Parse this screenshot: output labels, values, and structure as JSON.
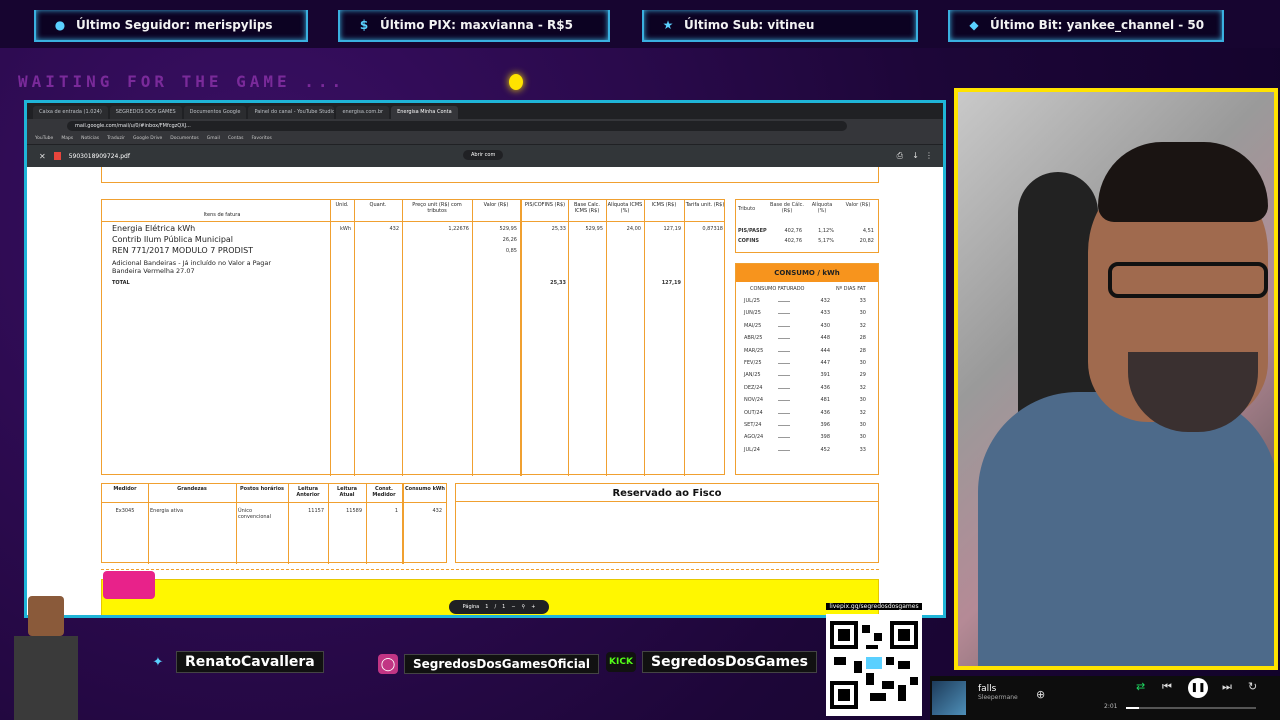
{
  "alerts": [
    {
      "icon": "user-icon",
      "label": "Último Seguidor: merispylips"
    },
    {
      "icon": "dollar-icon",
      "label": "Último PIX: maxvianna - R$5"
    },
    {
      "icon": "star-icon",
      "label": "Último Sub: vitineu"
    },
    {
      "icon": "diamond-icon",
      "label": "Último Bit: yankee_channel - 50"
    }
  ],
  "waiting_text": "WAITING FOR THE GAME ...",
  "browser": {
    "tabs": [
      "Caixa de entrada (1.024)",
      "SEGREDOS DOS GAMES",
      "Documentos Google",
      "Painel do canal - YouTube Studio",
      "energisa.com.br",
      "Energisa Minha Conta"
    ],
    "url": "mail.google.com/mail/u/0/#inbox/FMfcgzQXJ...",
    "bookmarks": [
      "YouTube",
      "Maps",
      "Notícias",
      "Traduzir",
      "Google Drive",
      "Documentos",
      "Gmail",
      "Contas",
      "Favoritos"
    ],
    "pdf_name": "5903018909724.pdf",
    "pdf_zoom": "Abrir com",
    "pager": {
      "label": "Página",
      "current": "1",
      "sep": "/",
      "total": "1"
    }
  },
  "bill": {
    "headers": [
      "Itens de fatura",
      "Unid.",
      "Quant.",
      "Preço unit (R$) com tributos",
      "Valor (R$)",
      "PIS/COFINS (R$)",
      "Base Calc. ICMS (R$)",
      "Alíquota ICMS (%)",
      "ICMS (R$)",
      "Tarifa unit. (R$)"
    ],
    "lines": [
      "Energia Elétrica kWh",
      "Contrib Ilum Pública Municipal",
      "REN 771/2017 MODULO 7 PRODIST",
      "Adicional Bandeiras - Já incluído no Valor a Pagar",
      "Bandeira Vermelha 27.07"
    ],
    "total_label": "TOTAL",
    "pis_total": "25,33",
    "icms_total": "127,19",
    "row1": {
      "unit": "kWh",
      "qty": "432",
      "price": "1,22676",
      "value": "529,95",
      "pis": "25,33",
      "base": "529,95",
      "aliq": "24,00",
      "icms": "127,19",
      "tarifa": "0,87318"
    },
    "row2_value": "26,26",
    "row3_value": "0,85"
  },
  "tributo": {
    "headers": [
      "Tributo",
      "Base de Cálc. (R$)",
      "Alíquota (%)",
      "Valor (R$)"
    ],
    "rows": [
      {
        "name": "PIS/PASEP",
        "base": "402,76",
        "aliq": "1,12%",
        "valor": "4,51"
      },
      {
        "name": "COFINS",
        "base": "402,76",
        "aliq": "5,17%",
        "valor": "20,82"
      }
    ]
  },
  "consumo": {
    "title": "CONSUMO / kWh",
    "headers": [
      "CONSUMO FATURADO",
      "Nº DIAS FAT"
    ],
    "rows": [
      {
        "m": "JUL/25",
        "v": "432",
        "d": "33"
      },
      {
        "m": "JUN/25",
        "v": "433",
        "d": "30"
      },
      {
        "m": "MAI/25",
        "v": "430",
        "d": "32"
      },
      {
        "m": "ABR/25",
        "v": "448",
        "d": "28"
      },
      {
        "m": "MAR/25",
        "v": "444",
        "d": "28"
      },
      {
        "m": "FEV/25",
        "v": "447",
        "d": "30"
      },
      {
        "m": "JAN/25",
        "v": "391",
        "d": "29"
      },
      {
        "m": "DEZ/24",
        "v": "436",
        "d": "32"
      },
      {
        "m": "NOV/24",
        "v": "481",
        "d": "30"
      },
      {
        "m": "OUT/24",
        "v": "436",
        "d": "32"
      },
      {
        "m": "SET/24",
        "v": "396",
        "d": "30"
      },
      {
        "m": "AGO/24",
        "v": "398",
        "d": "30"
      },
      {
        "m": "JUL/24",
        "v": "452",
        "d": "33"
      }
    ]
  },
  "medidor": {
    "headers": [
      "Medidor",
      "Grandezas",
      "Postos horários",
      "Leitura Anterior",
      "Leitura Atual",
      "Const. Medidor",
      "Consumo kWh"
    ],
    "row": {
      "medidor": "Ex3045",
      "grandeza": "Energia ativa",
      "posto": "Único convencional",
      "anterior": "11157",
      "atual": "11589",
      "const": "1",
      "consumo": "432"
    }
  },
  "fisco_title": "Reservado ao Fisco",
  "socials": [
    {
      "icon": "twitter-icon",
      "label": "RenatoCavallera"
    },
    {
      "icon": "instagram-icon",
      "label": "SegredosDosGamesOficial"
    },
    {
      "icon": "kick-icon",
      "label": "SegredosDosGames",
      "badge": "KICK"
    }
  ],
  "qr_label": "livepix.gg/segredosdosgames",
  "spotify": {
    "title": "falls",
    "artist": "Sleepermane",
    "time": "2:01",
    "progress": 0.1
  },
  "colors": {
    "accent_cyan": "#1fb5d8",
    "webcam_border": "#ffe300",
    "bill_orange": "#f7941d"
  }
}
